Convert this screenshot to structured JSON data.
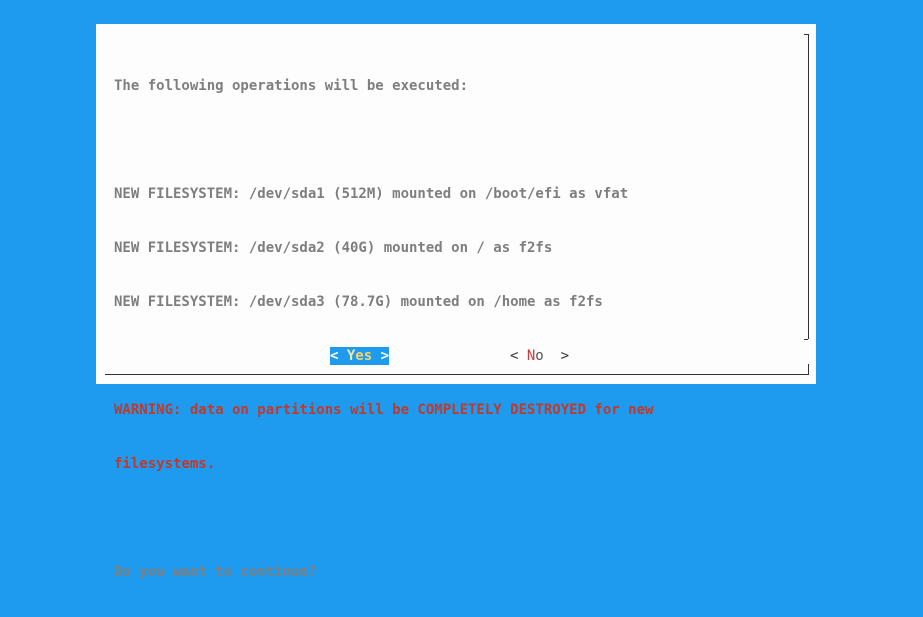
{
  "dialog": {
    "lines": [
      "The following operations will be executed:",
      "",
      "NEW FILESYSTEM: /dev/sda1 (512M) mounted on /boot/efi as vfat",
      "NEW FILESYSTEM: /dev/sda2 (40G) mounted on / as f2fs",
      "NEW FILESYSTEM: /dev/sda3 (78.7G) mounted on /home as f2fs",
      ""
    ],
    "warning_line1": "WARNING: data on partitions will be COMPLETELY DESTROYED for new",
    "warning_line2": "filesystems.",
    "question": "Do you want to continue?"
  },
  "buttons": {
    "yes": {
      "left": "< ",
      "hotkey": "Y",
      "rest": "es",
      "right": " >"
    },
    "no": {
      "left": "< ",
      "hotkey": "N",
      "rest": "o",
      "right": "  >"
    }
  },
  "colors": {
    "background": "#1e9bef",
    "dialog": "#fdfdfd",
    "text": "#7e7e7e",
    "warning": "#c0392b",
    "selected_button_bg": "#1e9bef"
  }
}
